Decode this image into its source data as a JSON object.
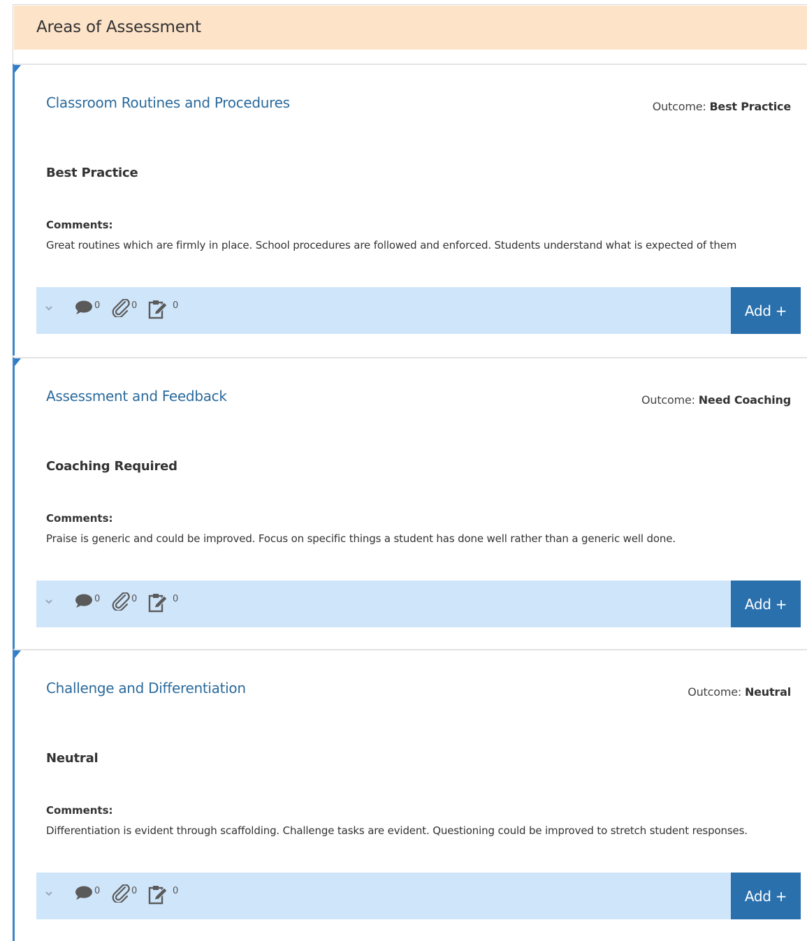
{
  "header": {
    "title": "Areas of Assessment"
  },
  "colors": {
    "header_bg": "#fde3c8",
    "accent_border": "#3f83c9",
    "toolbar_bg": "#cfe5fa",
    "add_button_bg": "#2a70ad",
    "title_text": "#2a6a9c"
  },
  "areas": [
    {
      "title": "Classroom Routines and Procedures",
      "outcome_label": "Outcome:",
      "outcome_value": "Best Practice",
      "rating": "Best Practice",
      "comments_label": "Comments:",
      "comments_text": "Great routines which are firmly in place. School procedures are followed and enforced. Students understand what is expected of them",
      "toolbar": {
        "expand_icon": "chevron-down-icon",
        "comment_count": "0",
        "attachment_count": "0",
        "task_count": "0",
        "add_label": "Add +"
      }
    },
    {
      "title": "Assessment and Feedback",
      "outcome_label": "Outcome:",
      "outcome_value": "Need Coaching",
      "rating": "Coaching Required",
      "comments_label": "Comments:",
      "comments_text": "Praise is generic and could be improved. Focus on specific things a student has done well rather than a generic well done.",
      "toolbar": {
        "expand_icon": "chevron-down-icon",
        "comment_count": "0",
        "attachment_count": "0",
        "task_count": "0",
        "add_label": "Add +"
      }
    },
    {
      "title": "Challenge and Differentiation",
      "outcome_label": "Outcome:",
      "outcome_value": "Neutral",
      "rating": "Neutral",
      "comments_label": "Comments:",
      "comments_text": "Differentiation is evident through scaffolding. Challenge tasks are evident. Questioning could be improved to stretch student responses.",
      "toolbar": {
        "expand_icon": "chevron-down-icon",
        "comment_count": "0",
        "attachment_count": "0",
        "task_count": "0",
        "add_label": "Add +"
      }
    }
  ]
}
